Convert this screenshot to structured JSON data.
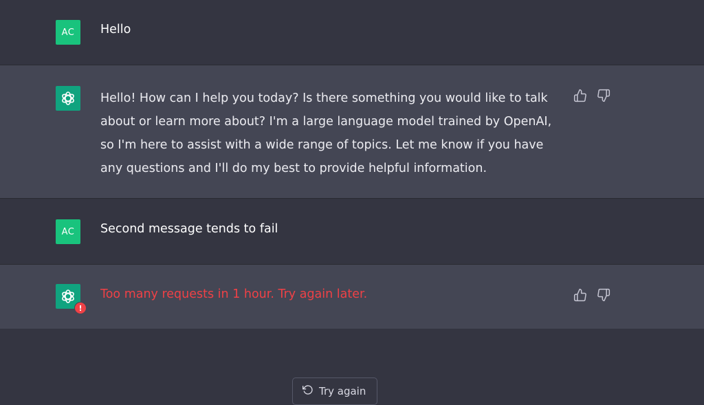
{
  "conversation": {
    "messages": [
      {
        "role": "user",
        "avatar": "AC",
        "text": "Hello"
      },
      {
        "role": "assistant",
        "text": "Hello! How can I help you today? Is there something you would like to talk about or learn more about? I'm a large language model trained by OpenAI, so I'm here to assist with a wide range of topics. Let me know if you have any questions and I'll do my best to provide helpful information."
      },
      {
        "role": "user",
        "avatar": "AC",
        "text": "Second message tends to fail"
      },
      {
        "role": "assistant",
        "error": true,
        "text": "Too many requests in 1 hour. Try again later."
      }
    ]
  },
  "error_badge": "!",
  "retry": {
    "label": "Try again",
    "icon": "refresh-icon"
  },
  "colors": {
    "background": "#343541",
    "assistant_row": "#444654",
    "accent": "#10a37f",
    "error": "#ef4146"
  }
}
